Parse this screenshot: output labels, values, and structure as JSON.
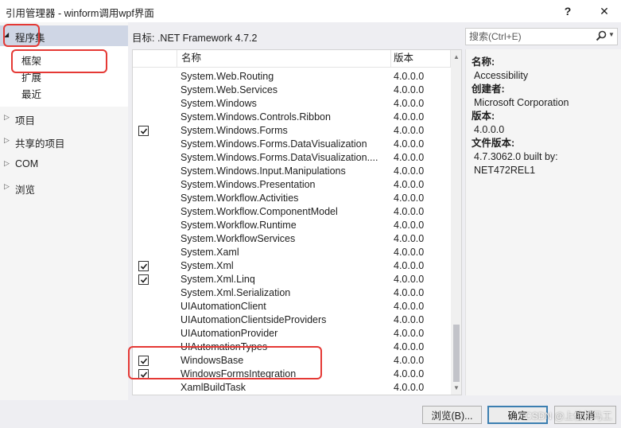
{
  "window": {
    "title": "引用管理器 - winform调用wpf界面",
    "help_label": "?",
    "close_label": "✕"
  },
  "nav": {
    "head_label": "程序集",
    "sub_items": [
      "框架",
      "扩展",
      "最近"
    ],
    "groups": [
      "项目",
      "共享的项目",
      "COM",
      "浏览"
    ]
  },
  "target": {
    "label": "目标: .NET Framework 4.7.2"
  },
  "search": {
    "placeholder": "搜索(Ctrl+E)",
    "value": ""
  },
  "list": {
    "columns": {
      "name": "名称",
      "version": "版本"
    },
    "rows": [
      {
        "name": "System.Web.Routing",
        "version": "4.0.0.0",
        "checked": false
      },
      {
        "name": "System.Web.Services",
        "version": "4.0.0.0",
        "checked": false
      },
      {
        "name": "System.Windows",
        "version": "4.0.0.0",
        "checked": false
      },
      {
        "name": "System.Windows.Controls.Ribbon",
        "version": "4.0.0.0",
        "checked": false
      },
      {
        "name": "System.Windows.Forms",
        "version": "4.0.0.0",
        "checked": true
      },
      {
        "name": "System.Windows.Forms.DataVisualization",
        "version": "4.0.0.0",
        "checked": false
      },
      {
        "name": "System.Windows.Forms.DataVisualization....",
        "version": "4.0.0.0",
        "checked": false
      },
      {
        "name": "System.Windows.Input.Manipulations",
        "version": "4.0.0.0",
        "checked": false
      },
      {
        "name": "System.Windows.Presentation",
        "version": "4.0.0.0",
        "checked": false
      },
      {
        "name": "System.Workflow.Activities",
        "version": "4.0.0.0",
        "checked": false
      },
      {
        "name": "System.Workflow.ComponentModel",
        "version": "4.0.0.0",
        "checked": false
      },
      {
        "name": "System.Workflow.Runtime",
        "version": "4.0.0.0",
        "checked": false
      },
      {
        "name": "System.WorkflowServices",
        "version": "4.0.0.0",
        "checked": false
      },
      {
        "name": "System.Xaml",
        "version": "4.0.0.0",
        "checked": false
      },
      {
        "name": "System.Xml",
        "version": "4.0.0.0",
        "checked": true
      },
      {
        "name": "System.Xml.Linq",
        "version": "4.0.0.0",
        "checked": true
      },
      {
        "name": "System.Xml.Serialization",
        "version": "4.0.0.0",
        "checked": false
      },
      {
        "name": "UIAutomationClient",
        "version": "4.0.0.0",
        "checked": false
      },
      {
        "name": "UIAutomationClientsideProviders",
        "version": "4.0.0.0",
        "checked": false
      },
      {
        "name": "UIAutomationProvider",
        "version": "4.0.0.0",
        "checked": false
      },
      {
        "name": "UIAutomationTypes",
        "version": "4.0.0.0",
        "checked": false
      },
      {
        "name": "WindowsBase",
        "version": "4.0.0.0",
        "checked": true
      },
      {
        "name": "WindowsFormsIntegration",
        "version": "4.0.0.0",
        "checked": true
      },
      {
        "name": "XamlBuildTask",
        "version": "4.0.0.0",
        "checked": false
      }
    ]
  },
  "detail": {
    "name_label": "名称:",
    "name_value": "Accessibility",
    "creator_label": "创建者:",
    "creator_value": "Microsoft Corporation",
    "version_label": "版本:",
    "version_value": "4.0.0.0",
    "file_version_label": "文件版本:",
    "file_version_value_1": "4.7.3062.0 built by:",
    "file_version_value_2": "NET472REL1"
  },
  "buttons": {
    "browse": "浏览(B)...",
    "ok": "确定",
    "cancel": "取消"
  },
  "watermark": "CSDN @上位机马工",
  "colors": {
    "nav_selected": "#cfd6e5",
    "highlight": "#e53935",
    "ok_border": "#3c7fb1"
  }
}
